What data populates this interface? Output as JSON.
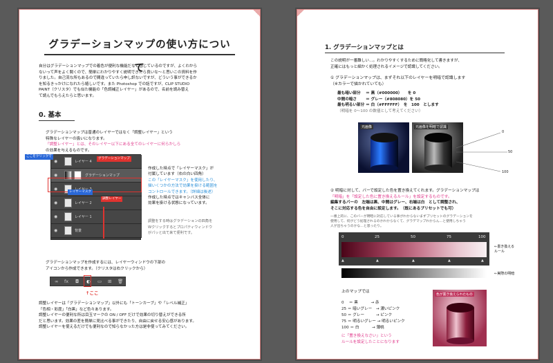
{
  "left": {
    "title": "グラデーションマップの使い方について",
    "intro": [
      "自分はグラデーションマップでの着色が便利な機能だなと感じているのですが、よくわから",
      "ないって声をよく聞くので、簡単にわかりやすく説明できたら良いな～と思いこの資料を作",
      "りました。自己流な所もあるので間違っていたら申し訳ないですが、どういう事ができるか",
      "を知るきっかけになれたら嬉しいです。また Photoshop での話ですが、CLIP STUDIO",
      "PAINT（クリスタ）でも似た機能の「色調補正レイヤー」があるので、名前を読み替え",
      "て読んでもらえたらと思います。"
    ],
    "section0": "0. 基本",
    "basic_text": [
      "グラデーションマップは普通のレイヤーではなく「調整レイヤー」という",
      "特殊なレイヤーの扱いになります。",
      "「調整レイヤー」とは、そのレイヤー以下にある全てのレイヤーに何らかしら",
      "の効果を与えるものです。"
    ],
    "layers": [
      "レイヤー 4",
      "グラデーションマップ",
      "レイヤー 3",
      "レイヤー 2",
      "レイヤー 1",
      "背景"
    ],
    "annotation_red1": "グラデーションマップ",
    "annotation_blue1": "レイヤーマスク",
    "annotation_blue0": "ここをクリックで",
    "annotation_red2": "調整レイヤー",
    "side_text": [
      "作成した時点で「レイヤーマスク」が",
      "付属しています（右の白い四角）",
      "この「レイヤーマスク」を使用したり、",
      "描いくつかの方法で効果を掛ける範囲を",
      "コントロールできます。（詳細は後述）",
      "作成した時点ではキャンバス全体に",
      "効果を掛ける状態になっています。"
    ],
    "side_note": [
      "調整をする時はグラデーションの四角を",
      "Wクリックするとプロパティウィンドウ",
      "がパッと出て来て便利です。"
    ],
    "create_text": [
      "グラデーションマップを作成するには、レイヤーウィンドウの下部の",
      "アイコンから作成できます。（クリスタは右クリックから）"
    ],
    "toolbar_icons": [
      "∞",
      "fx",
      "◘",
      "◐",
      "▭",
      "⊞",
      "🗑"
    ],
    "here": "↑ここ",
    "bottom_text": [
      "調整レイヤーは「グラデーションマップ」以外にも「トーンカーブ」や「レベル補正」",
      "「色相・彩度」「白黒」など色々あります。",
      "調整レイヤーの便利な所は目玉マークの ON / OFF だけで効果の切り替えができる所",
      "だと思います。効果の差を簡単に見比べる事ができたり、自由に戻せる安心感があります。",
      "調整レイヤーを使えるだけでも便利なので知らなかった方は是非使ってみてください。"
    ]
  },
  "right": {
    "section1": "1. グラデーションマップとは",
    "s1_intro": [
      "この説明が一番難しい…。わかりやすくするために簡略化して書きますが、",
      "正確にはもっと細かく処理されるイメージで認識してください。"
    ],
    "point1": [
      "① グラデーションマップは、まずそれ以下のレイヤーを明暗で認識します",
      "（※カラーで描かれていても）"
    ],
    "levels": [
      "最も暗い部分　 ＝ 黒（#000000）　　を 0",
      "中間の暗さ　　 ＝ グレー（#808080）を 50",
      "最も明るい部分 ＝ 白（#FFFFFF）　を　100　とします",
      "（明暗を 0～100 の数値として考えてください）"
    ],
    "img1_label": "元画像",
    "img2_label": "元画像を明暗で認識",
    "scale_labels": [
      "0",
      "50",
      "100"
    ],
    "point2": [
      "② 明暗に対して、バーで設定した色を置き換えてくれます。グラデーションマップは",
      "「明暗」を「設定した色に置き換えるルール」を設定するものです。",
      "編集するバーの　左端は黒、中間はグレー、右端は白　として調整され、",
      "そこに対応する色を自由に設定します。（既にあるプリセットでも可）"
    ],
    "note2": [
      "一番上的に、このバーが明暗に対応している事がわからないまずプリセットのグラデーションを",
      "使用して、何がどう処理されるのかわからなくて、グラデマップわからん…と使用しちゃう",
      "人が出ちゃうのかな…と思ったり。"
    ],
    "ramp_ticks": [
      "0",
      "25",
      "50",
      "75",
      "100"
    ],
    "ramp_rule": "←書き換える\nルール",
    "ramp_actual": "←実際の明暗",
    "map_title": "上のマップでは",
    "map_rows": [
      "0　 ＝ 黒　　　 → 赤",
      "25 ＝ 暗いグレー　→ 濃いピンク",
      "50 ＝ グレー　　　→ ピンク",
      "75 ＝ 明るいグレー → 明るいピンク",
      "100 ＝ 白　　　 → 薄桃"
    ],
    "map_conclusion": [
      "に「置き換えなさい」という",
      "ルールを設定したことになります"
    ],
    "img3_label": "色が置き換えられたもの"
  },
  "colors": {
    "accent_pink": "#e03a8c",
    "accent_blue": "#2a8fd8",
    "accent_red": "#e0332f",
    "bg": "#5a5a5a"
  }
}
